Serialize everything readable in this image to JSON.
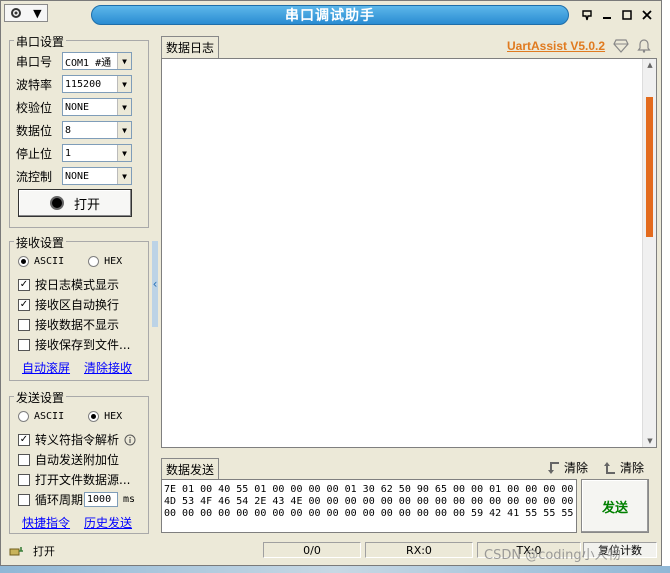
{
  "window": {
    "title": "串口调试助手",
    "sysmenu_arrow": "▼"
  },
  "serial": {
    "group_title": "串口设置",
    "port_label": "串口号",
    "port_value": "COM1 #通",
    "baud_label": "波特率",
    "baud_value": "115200",
    "parity_label": "校验位",
    "parity_value": "NONE",
    "databits_label": "数据位",
    "databits_value": "8",
    "stopbits_label": "停止位",
    "stopbits_value": "1",
    "flow_label": "流控制",
    "flow_value": "NONE",
    "open_button": "打开"
  },
  "receive": {
    "group_title": "接收设置",
    "ascii_label": "ASCII",
    "hex_label": "HEX",
    "selected_mode": "ASCII",
    "log_mode_label": "按日志模式显示",
    "log_mode_checked": true,
    "auto_wrap_label": "接收区自动换行",
    "auto_wrap_checked": true,
    "hide_label": "接收数据不显示",
    "hide_checked": false,
    "save_label": "接收保存到文件...",
    "save_checked": false,
    "auto_scroll_link": "自动滚屏",
    "clear_link": "清除接收"
  },
  "send": {
    "group_title": "发送设置",
    "ascii_label": "ASCII",
    "hex_label": "HEX",
    "selected_mode": "HEX",
    "escape_label": "转义符指令解析",
    "escape_checked": true,
    "append_label": "自动发送附加位",
    "append_checked": false,
    "file_label": "打开文件数据源...",
    "file_checked": false,
    "cycle_label": "循环周期",
    "cycle_checked": false,
    "cycle_value": "1000",
    "cycle_unit": "ms",
    "shortcut_link": "快捷指令",
    "history_link": "历史发送"
  },
  "log_panel": {
    "tab_label": "数据日志",
    "brand": "UartAssist V5.0.2"
  },
  "send_panel": {
    "tab_label": "数据发送",
    "clear_label_1": "清除",
    "clear_label_2": "清除",
    "content": "7E 01 00 40 55 01 00 00 00 00 01 30 62 50 90 65 00 00 01 00 00 00 00 43\n4D 53 4F 46 54 2E 43 4E 00 00 00 00 00 00 00 00 00 00 00 00 00 00 00 00\n00 00 00 00 00 00 00 00 00 00 00 00 00 00 00 00 00 59 42 41 55 55 55 51",
    "send_button": "发送"
  },
  "status": {
    "state": "打开",
    "counter": "0/0",
    "rx": "RX:0",
    "tx": "TX:0",
    "reset": "复位计数"
  },
  "watermark": "CSDN @coding小人物",
  "colors": {
    "title_blue": "#2a8cd2",
    "brand_orange": "#e07a1f",
    "send_green": "#008000",
    "link_blue": "#0000ff"
  }
}
